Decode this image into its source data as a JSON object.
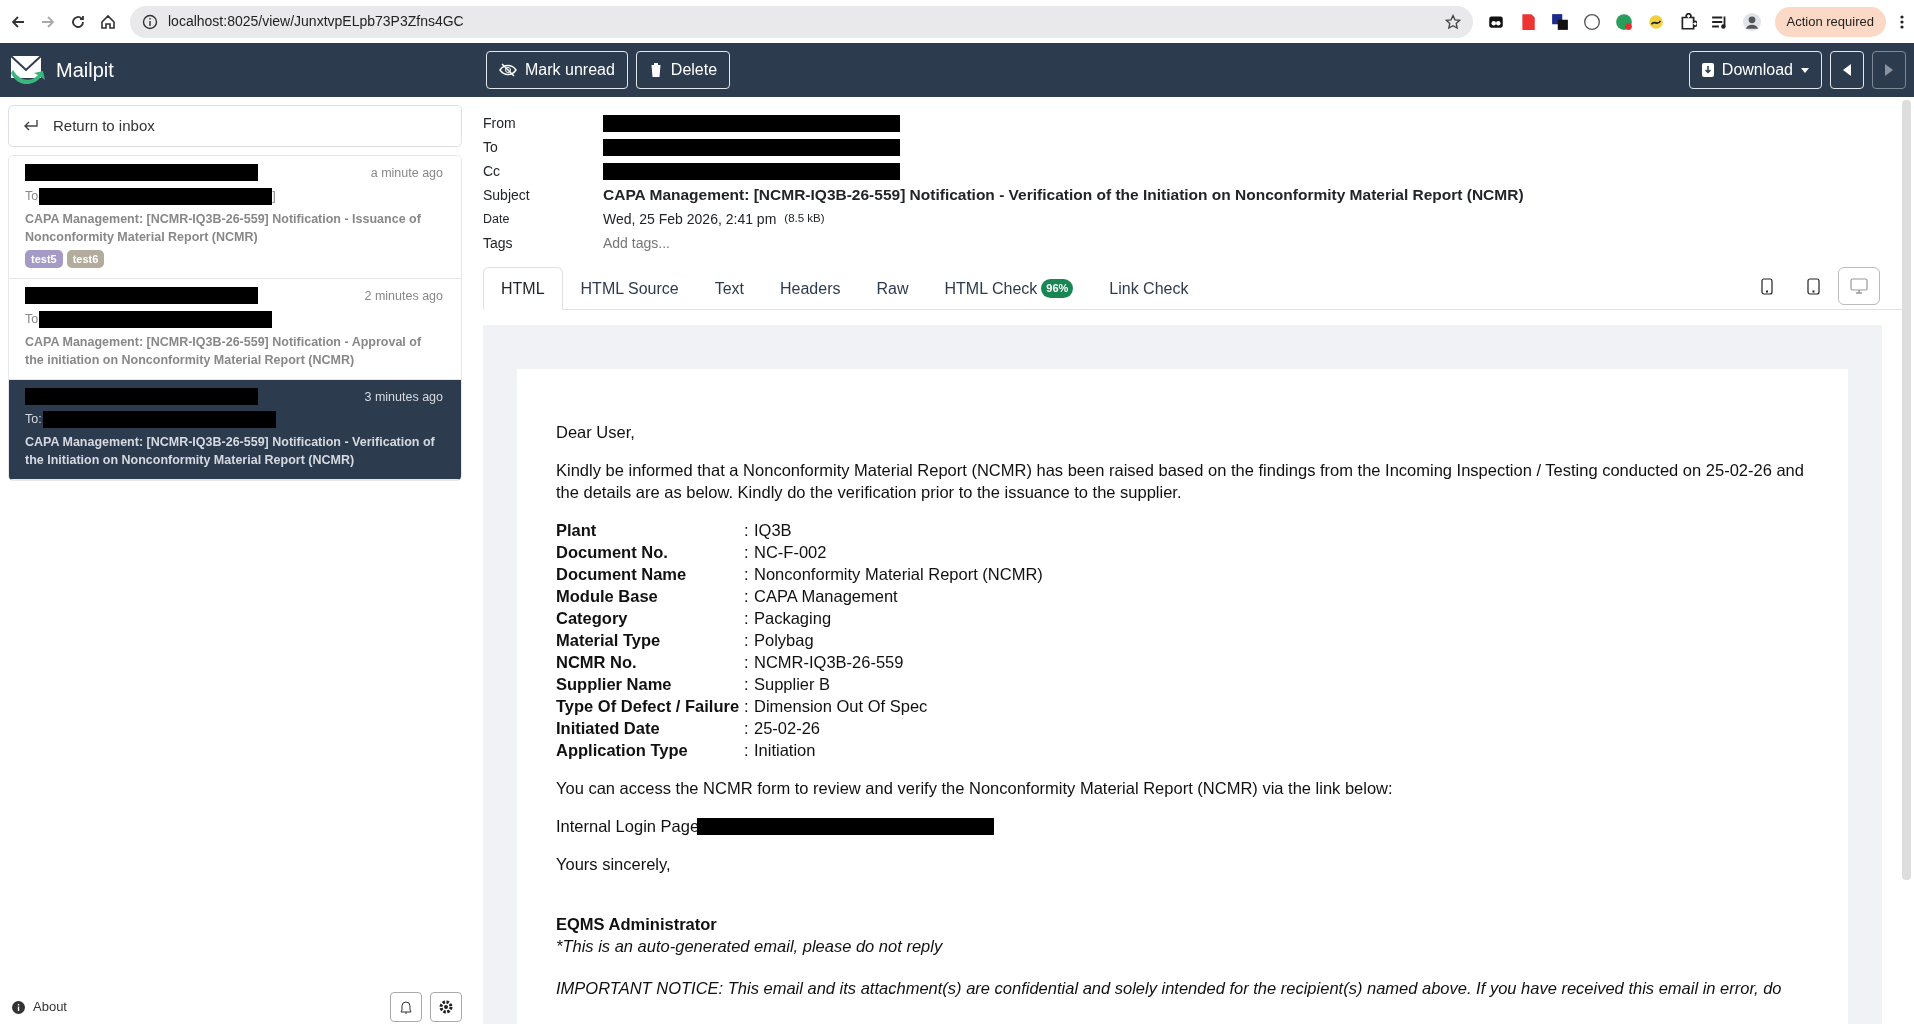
{
  "browser": {
    "url": "localhost:8025/view/JunxtvpELpb73P3Zfns4GC",
    "forward_disabled": true,
    "action_button": "Action required"
  },
  "navbar": {
    "brand": "Mailpit",
    "buttons": [
      {
        "kind": "unread",
        "label": "Mark unread"
      },
      {
        "kind": "delete",
        "label": "Delete"
      }
    ],
    "download": "Download",
    "prev_disabled": false,
    "next_disabled": true
  },
  "sidebar": {
    "return_link": "Return to inbox",
    "messages": [
      {
        "time": "a minute ago",
        "to_label": "To",
        "to_suffix": "]",
        "subject": "CAPA Management: [NCMR-IQ3B-26-559] Notification - Issuance of Nonconformity Material Report (NCMR)",
        "tags": [
          {
            "label": "test5",
            "color": "#a59ac6"
          },
          {
            "label": "test6",
            "color": "#b3ab9c"
          }
        ],
        "selected": false
      },
      {
        "time": "2 minutes ago",
        "to_label": "To",
        "subject": "CAPA Management: [NCMR-IQ3B-26-559] Notification - Approval of the initiation on Nonconformity Material Report (NCMR)",
        "selected": false
      },
      {
        "time": "3 minutes ago",
        "to_label": "To:",
        "subject": "CAPA Management: [NCMR-IQ3B-26-559] Notification - Verification of the Initiation on Nonconformity Material Report (NCMR)",
        "selected": true
      }
    ],
    "about": "About"
  },
  "headers": {
    "from_label": "From",
    "to_label": "To",
    "cc_label": "Cc",
    "subject_label": "Subject",
    "subject": "CAPA Management: [NCMR-IQ3B-26-559] Notification - Verification of the Initiation on Nonconformity Material Report (NCMR)",
    "date_label": "Date",
    "date": "Wed, 25 Feb 2026, 2:41 pm",
    "size": "(8.5 kB)",
    "tags_label": "Tags",
    "tags_placeholder": "Add tags..."
  },
  "tabs": [
    {
      "label": "HTML",
      "selected": true
    },
    {
      "label": "HTML Source",
      "selected": false
    },
    {
      "label": "Text",
      "selected": false
    },
    {
      "label": "Headers",
      "selected": false
    },
    {
      "label": "Raw",
      "selected": false
    },
    {
      "label": "HTML Check",
      "badge": "96%",
      "selected": false
    },
    {
      "label": "Link Check",
      "selected": false
    }
  ],
  "view_modes": [
    {
      "kind": "phone",
      "selected": false
    },
    {
      "kind": "tablet",
      "selected": false
    },
    {
      "kind": "desktop",
      "selected": true
    }
  ],
  "email": {
    "greeting": "Dear User,",
    "intro": "Kindly be informed that a Nonconformity Material Report (NCMR) has been raised based on the findings from the Incoming Inspection / Testing conducted on 25-02-26 and the details are as below. Kindly do the verification prior to the issuance to the supplier.",
    "fields": [
      {
        "label": "Plant",
        "sep": ":",
        "value": "IQ3B"
      },
      {
        "label": "Document No.",
        "sep": ":",
        "value": "NC-F-002"
      },
      {
        "label": "Document Name",
        "sep": ":",
        "value": "Nonconformity Material Report (NCMR)"
      },
      {
        "label": "Module Base",
        "sep": ":",
        "value": "CAPA Management"
      },
      {
        "label": "Category",
        "sep": ":",
        "value": "Packaging"
      },
      {
        "label": "Material Type",
        "sep": ":",
        "value": "Polybag"
      },
      {
        "label": "NCMR No.",
        "sep": ":",
        "value": "NCMR-IQ3B-26-559"
      },
      {
        "label": "Supplier Name",
        "sep": ":",
        "value": "Supplier B"
      },
      {
        "label": "Type Of Defect / Failure",
        "sep": ":",
        "value": "Dimension Out Of Spec"
      },
      {
        "label": "Initiated Date",
        "sep": ":",
        "value": "25-02-26"
      },
      {
        "label": "Application Type",
        "sep": ":",
        "value": "Initiation"
      }
    ],
    "access": "You can access the NCMR form to review and verify the Nonconformity Material Report (NCMR) via the link below:",
    "login_label": "Internal Login Page",
    "closing": "Yours sincerely,",
    "signature": "EQMS Administrator",
    "auto_note": "*This is an auto-generated email, please do not reply",
    "notice": "IMPORTANT NOTICE: This email and its attachment(s) are confidential and solely intended for the recipient(s) named above. If you have received this email in error, do"
  }
}
